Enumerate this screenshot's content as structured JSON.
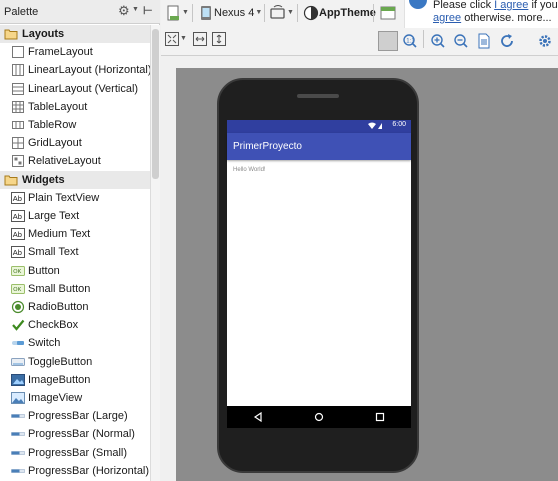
{
  "palette": {
    "title": "Palette",
    "items": [
      {
        "type": "category",
        "label": "Layouts",
        "icon": "folder-icon"
      },
      {
        "type": "item",
        "label": "FrameLayout",
        "icon": "frame-layout-icon"
      },
      {
        "type": "item",
        "label": "LinearLayout (Horizontal)",
        "icon": "linear-horizontal-icon"
      },
      {
        "type": "item",
        "label": "LinearLayout (Vertical)",
        "icon": "linear-vertical-icon"
      },
      {
        "type": "item",
        "label": "TableLayout",
        "icon": "table-layout-icon"
      },
      {
        "type": "item",
        "label": "TableRow",
        "icon": "table-row-icon"
      },
      {
        "type": "item",
        "label": "GridLayout",
        "icon": "grid-layout-icon"
      },
      {
        "type": "item",
        "label": "RelativeLayout",
        "icon": "relative-layout-icon"
      },
      {
        "type": "category",
        "label": "Widgets",
        "icon": "folder-icon"
      },
      {
        "type": "item",
        "label": "Plain TextView",
        "icon": "textview-icon"
      },
      {
        "type": "item",
        "label": "Large Text",
        "icon": "textview-icon"
      },
      {
        "type": "item",
        "label": "Medium Text",
        "icon": "textview-icon"
      },
      {
        "type": "item",
        "label": "Small Text",
        "icon": "textview-icon"
      },
      {
        "type": "item",
        "label": "Button",
        "icon": "button-icon"
      },
      {
        "type": "item",
        "label": "Small Button",
        "icon": "button-icon"
      },
      {
        "type": "item",
        "label": "RadioButton",
        "icon": "radio-button-icon"
      },
      {
        "type": "item",
        "label": "CheckBox",
        "icon": "checkbox-icon"
      },
      {
        "type": "item",
        "label": "Switch",
        "icon": "switch-icon"
      },
      {
        "type": "item",
        "label": "ToggleButton",
        "icon": "toggle-button-icon"
      },
      {
        "type": "item",
        "label": "ImageButton",
        "icon": "image-button-icon"
      },
      {
        "type": "item",
        "label": "ImageView",
        "icon": "image-view-icon"
      },
      {
        "type": "item",
        "label": "ProgressBar (Large)",
        "icon": "progress-bar-icon"
      },
      {
        "type": "item",
        "label": "ProgressBar (Normal)",
        "icon": "progress-bar-icon"
      },
      {
        "type": "item",
        "label": "ProgressBar (Small)",
        "icon": "progress-bar-icon"
      },
      {
        "type": "item",
        "label": "ProgressBar (Horizontal)",
        "icon": "progress-bar-icon"
      }
    ]
  },
  "toolbar": {
    "device": "Nexus 4",
    "theme": "AppTheme"
  },
  "notice": {
    "line1_prefix": "Please click ",
    "line1_link": "I agree",
    "line1_suffix": " if you",
    "line2_link": "agree",
    "line2_suffix": " otherwise. more..."
  },
  "device_preview": {
    "time": "6:00",
    "app_title": "PrimerProyecto",
    "body_text": "Hello World!"
  },
  "colors": {
    "status_bar": "#303f9f",
    "app_bar": "#3f51b5",
    "canvas": "#8c8c8c",
    "link": "#2a5db0"
  }
}
